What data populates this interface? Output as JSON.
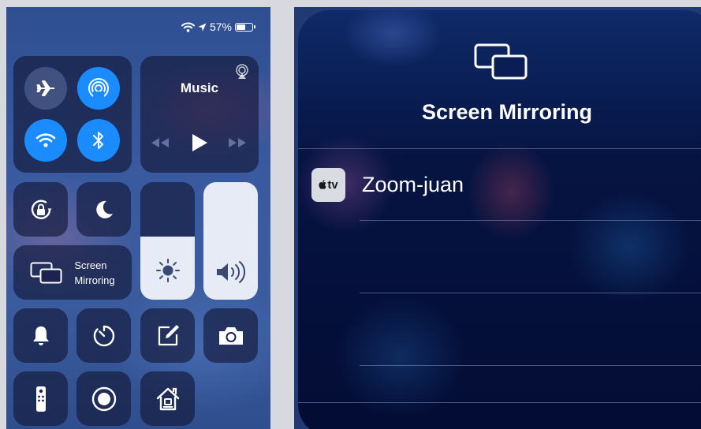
{
  "control_center": {
    "status": {
      "battery_text": "57%"
    },
    "connectivity": {
      "airplane": {
        "state": "off"
      },
      "airdrop": {
        "state": "on"
      },
      "wifi": {
        "state": "on"
      },
      "bluetooth": {
        "state": "on"
      }
    },
    "music": {
      "title": "Music"
    },
    "screen_mirroring": {
      "line1": "Screen",
      "line2": "Mirroring"
    },
    "brightness_level": 0.54,
    "volume_level": 1.0
  },
  "mirroring_sheet": {
    "title": "Screen Mirroring",
    "devices": [
      {
        "badge": "tv",
        "name": "Zoom-juan"
      }
    ]
  },
  "colors": {
    "accent": "#1a8cff"
  }
}
